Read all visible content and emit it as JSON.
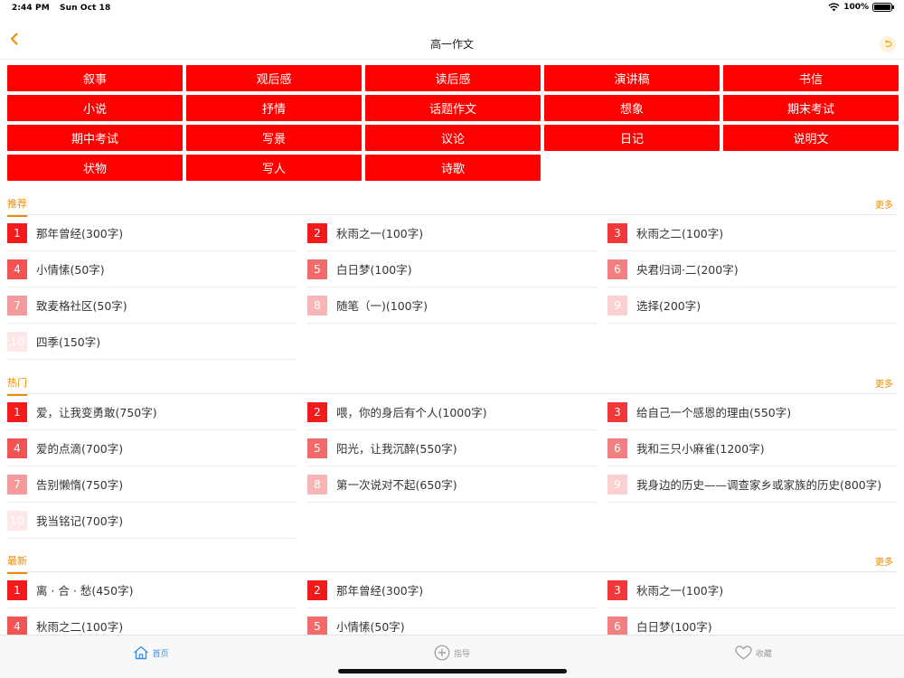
{
  "status": {
    "time": "2:44 PM",
    "date": "Sun Oct 18",
    "battery": "100%"
  },
  "nav": {
    "title": "高一作文"
  },
  "categories": [
    "叙事",
    "观后感",
    "读后感",
    "演讲稿",
    "书信",
    "小说",
    "抒情",
    "话题作文",
    "想象",
    "期末考试",
    "期中考试",
    "写景",
    "议论",
    "日记",
    "说明文",
    "状物",
    "写人",
    "诗歌"
  ],
  "sections": [
    {
      "title": "推荐",
      "more": "更多",
      "items": [
        {
          "num": "1",
          "text": "那年曾经(300字)"
        },
        {
          "num": "2",
          "text": "秋雨之一(100字)"
        },
        {
          "num": "3",
          "text": "秋雨之二(100字)"
        },
        {
          "num": "4",
          "text": "小情愫(50字)"
        },
        {
          "num": "5",
          "text": "白日梦(100字)"
        },
        {
          "num": "6",
          "text": "央君归词·二(200字)"
        },
        {
          "num": "7",
          "text": "致麦格社区(50字)"
        },
        {
          "num": "8",
          "text": "随笔（一)(100字)"
        },
        {
          "num": "9",
          "text": "选择(200字)"
        },
        {
          "num": "10",
          "text": "四季(150字)"
        }
      ]
    },
    {
      "title": "热门",
      "more": "更多",
      "items": [
        {
          "num": "1",
          "text": "爱，让我变勇敢(750字)"
        },
        {
          "num": "2",
          "text": "喂，你的身后有个人(1000字)"
        },
        {
          "num": "3",
          "text": "给自己一个感恩的理由(550字)"
        },
        {
          "num": "4",
          "text": "爱的点滴(700字)"
        },
        {
          "num": "5",
          "text": " 阳光，让我沉醉(550字)"
        },
        {
          "num": "6",
          "text": "我和三只小麻雀(1200字)"
        },
        {
          "num": "7",
          "text": "告别懒惰(750字)"
        },
        {
          "num": "8",
          "text": "第一次说对不起(650字)"
        },
        {
          "num": "9",
          "text": "我身边的历史——调查家乡或家族的历史(800字)"
        },
        {
          "num": "10",
          "text": "我当铭记(700字)"
        }
      ]
    },
    {
      "title": "最新",
      "more": "更多",
      "items": [
        {
          "num": "1",
          "text": "离 · 合 · 愁(450字)"
        },
        {
          "num": "2",
          "text": "那年曾经(300字)"
        },
        {
          "num": "3",
          "text": "秋雨之一(100字)"
        },
        {
          "num": "4",
          "text": "秋雨之二(100字)"
        },
        {
          "num": "5",
          "text": "小情愫(50字)"
        },
        {
          "num": "6",
          "text": "白日梦(100字)"
        }
      ]
    }
  ],
  "tabs": [
    {
      "label": "首页",
      "icon": "home-icon",
      "active": true
    },
    {
      "label": "指导",
      "icon": "plus-circle-icon",
      "active": false
    },
    {
      "label": "收藏",
      "icon": "heart-icon",
      "active": false
    }
  ],
  "colors": {
    "accent": "#f08a00",
    "category": "#ff0000",
    "tab_active": "#3a8ee6"
  }
}
